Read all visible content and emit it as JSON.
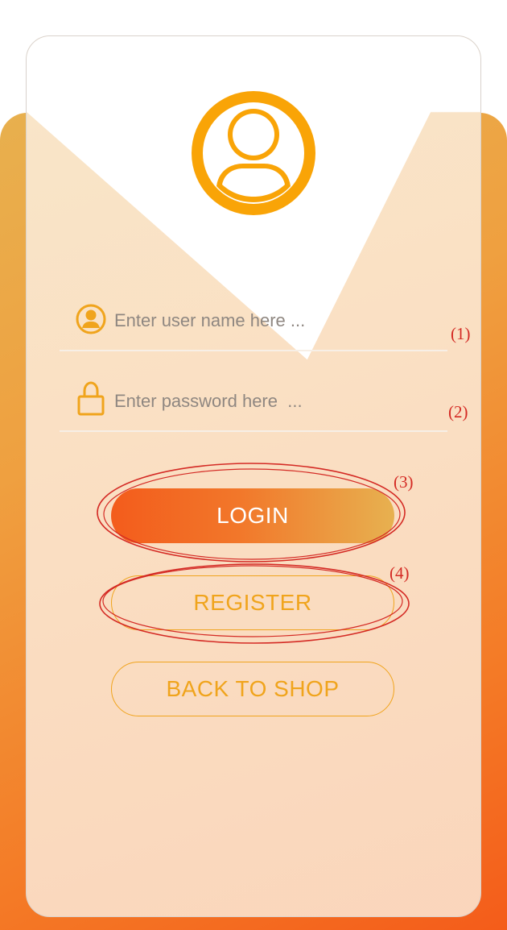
{
  "login_form": {
    "username": {
      "placeholder": "Enter user name here ...",
      "value": "",
      "icon": "user-circle-icon"
    },
    "password": {
      "placeholder": "Enter password here  ...",
      "value": "",
      "icon": "lock-icon"
    },
    "login_label": "LOGIN",
    "register_label": "REGISTER",
    "back_label": "BACK TO SHOP"
  },
  "avatar_icon": "user-avatar-icon",
  "annotations": {
    "marker_1": "(1)",
    "marker_2": "(2)",
    "marker_3": "(3)",
    "marker_4": "(4)"
  },
  "colors": {
    "accent": "#f0a41c",
    "login_gradient_start": "#f35c1c",
    "login_gradient_end": "#e7b150",
    "annotation_red": "#d42a24",
    "background_orange": "#f47a26"
  }
}
